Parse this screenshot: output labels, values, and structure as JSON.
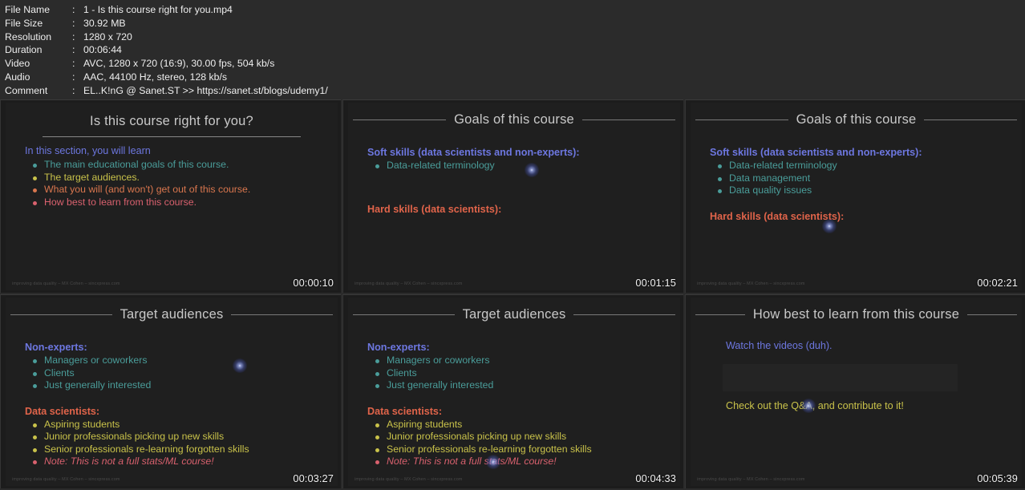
{
  "metadata": {
    "rows": [
      {
        "label": "File Name",
        "value": "1 - Is this course right for you.mp4"
      },
      {
        "label": "File Size",
        "value": "30.92 MB"
      },
      {
        "label": "Resolution",
        "value": "1280 x 720"
      },
      {
        "label": "Duration",
        "value": "00:06:44"
      },
      {
        "label": "Video",
        "value": "AVC, 1280 x 720 (16:9), 30.00 fps, 504 kb/s"
      },
      {
        "label": "Audio",
        "value": "AAC, 44100 Hz, stereo, 128 kb/s"
      },
      {
        "label": "Comment",
        "value": "EL..K!nG @ Sanet.ST >> https://sanet.st/blogs/udemy1/"
      }
    ],
    "colon": ":"
  },
  "watermark": "improving data quality – MX Cohen – sincxpress.com",
  "colors": {
    "background": "#2b2b2b",
    "slide_bg": "#1f1f1f",
    "title": "#c9c9c9",
    "heading_blue": "#6d77e0",
    "heading_salmon": "#e0644a",
    "bullet_teal": "#4a9d9a",
    "bullet_yellow": "#c9c24a",
    "bullet_orange": "#d9764e",
    "bullet_pink": "#d9616e",
    "timestamp": "#f2f2f2",
    "cursor_glow": "#8a9bea"
  },
  "thumbnails": [
    {
      "title": "Is this course right for you?",
      "timestamp": "00:00:10",
      "intro": "In this section, you will learn",
      "bullets": [
        {
          "text": "The main educational goals of this course.",
          "color": "teal"
        },
        {
          "text": "The target audiences.",
          "color": "yellow"
        },
        {
          "text": "What you will (and won't) get out of this course.",
          "color": "orange"
        },
        {
          "text": "How best to learn from this course.",
          "color": "pink"
        }
      ]
    },
    {
      "title": "Goals of this course",
      "timestamp": "00:01:15",
      "heading1": "Soft skills (data scientists and non-experts):",
      "group1": [
        "Data-related terminology"
      ],
      "heading2": "Hard skills (data scientists):",
      "group2": []
    },
    {
      "title": "Goals of this course",
      "timestamp": "00:02:21",
      "heading1": "Soft skills (data scientists and non-experts):",
      "group1": [
        "Data-related terminology",
        "Data management",
        "Data quality issues"
      ],
      "heading2": "Hard skills (data scientists):",
      "group2": []
    },
    {
      "title": "Target audiences",
      "timestamp": "00:03:27",
      "heading1": "Non-experts:",
      "group1": [
        "Managers or coworkers",
        "Clients",
        "Just generally interested"
      ],
      "heading2": "Data scientists:",
      "group2": [
        "Aspiring students",
        "Junior professionals picking up new skills",
        "Senior professionals re-learning forgotten skills"
      ],
      "note": "Note: This is not a full stats/ML course!"
    },
    {
      "title": "Target audiences",
      "timestamp": "00:04:33",
      "heading1": "Non-experts:",
      "group1": [
        "Managers or coworkers",
        "Clients",
        "Just generally interested"
      ],
      "heading2": "Data scientists:",
      "group2": [
        "Aspiring students",
        "Junior professionals picking up new skills",
        "Senior professionals re-learning forgotten skills"
      ],
      "note": "Note: This is not a full stats/ML course!"
    },
    {
      "title": "How best to learn from this course",
      "timestamp": "00:05:39",
      "line1": "Watch the videos (duh).",
      "line2": "Check out the Q&A, and contribute to it!"
    }
  ]
}
